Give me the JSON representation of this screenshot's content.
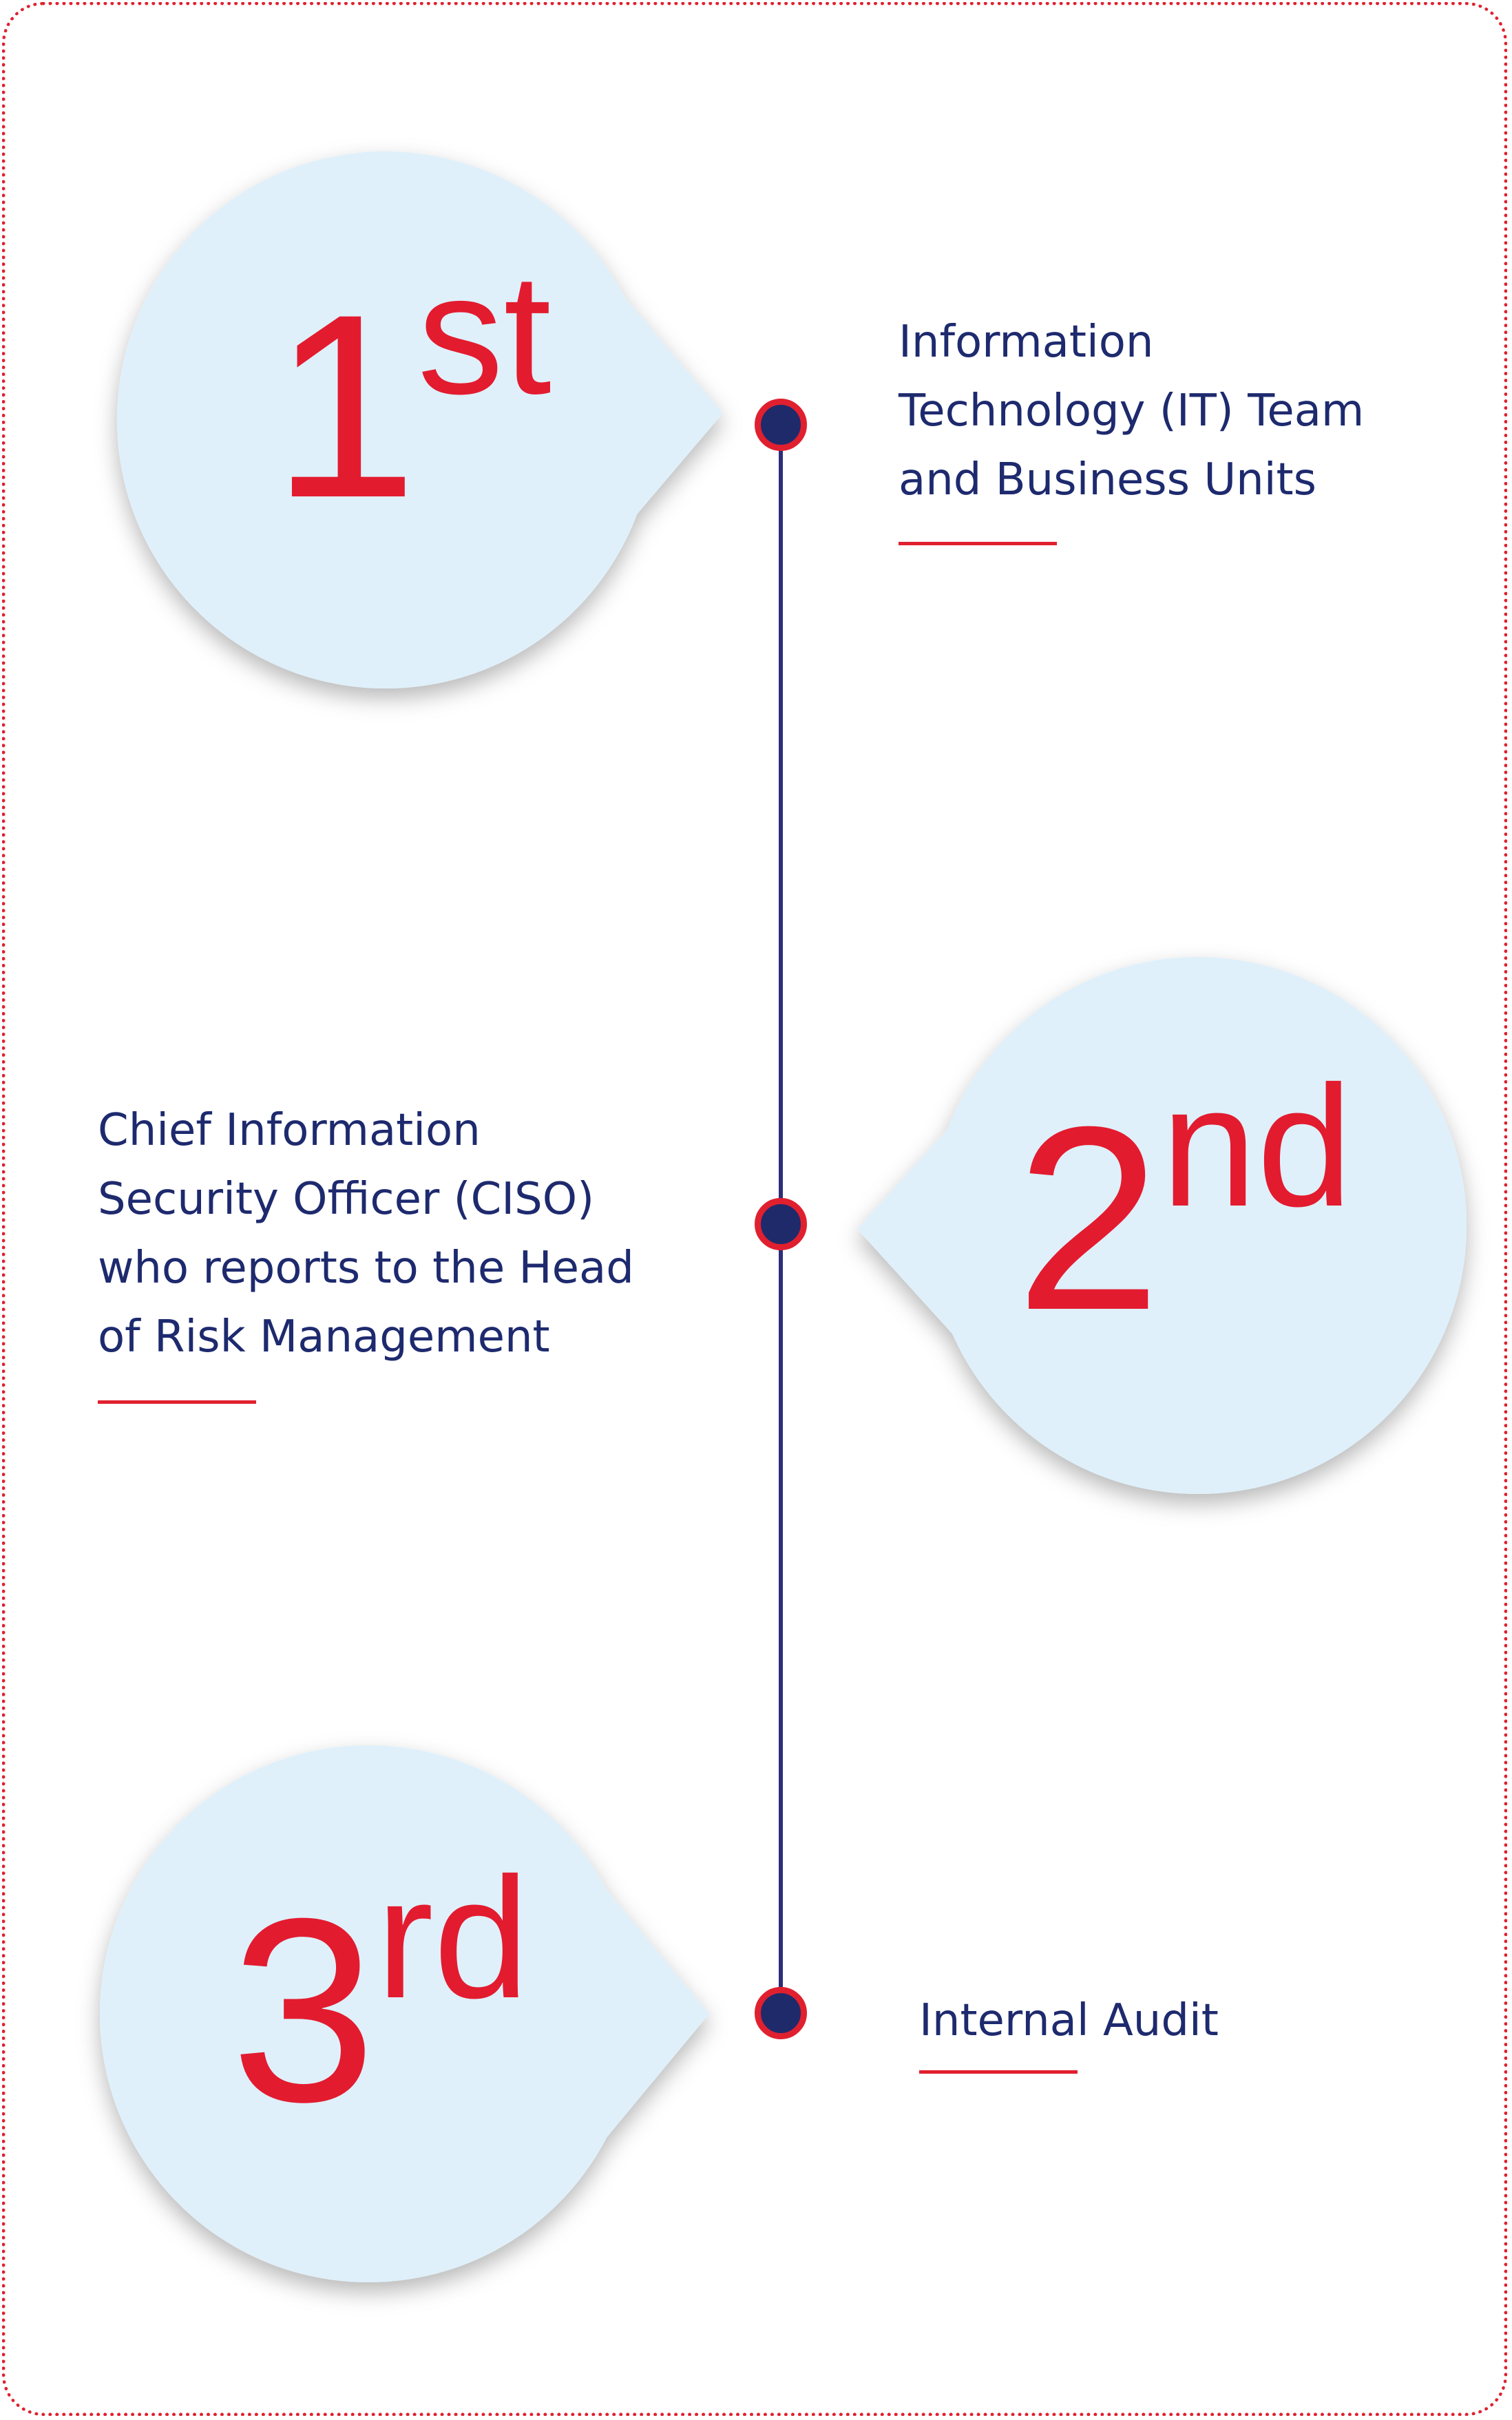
{
  "levels": [
    {
      "number": "1",
      "suffix": "st",
      "label_lines": [
        "Information",
        "Technology (IT) Team",
        "and Business Units"
      ]
    },
    {
      "number": "2",
      "suffix": "nd",
      "label_lines": [
        "Chief Information",
        "Security Officer (CISO)",
        "who reports to the Head",
        "of Risk Management"
      ]
    },
    {
      "number": "3",
      "suffix": "rd",
      "label_lines": [
        "Internal Audit"
      ]
    }
  ],
  "colors": {
    "accent_red": "#e31b2f",
    "navy": "#1e2a6e",
    "bubble_fill": "#dff0fa",
    "frame_border": "#e0202f"
  }
}
